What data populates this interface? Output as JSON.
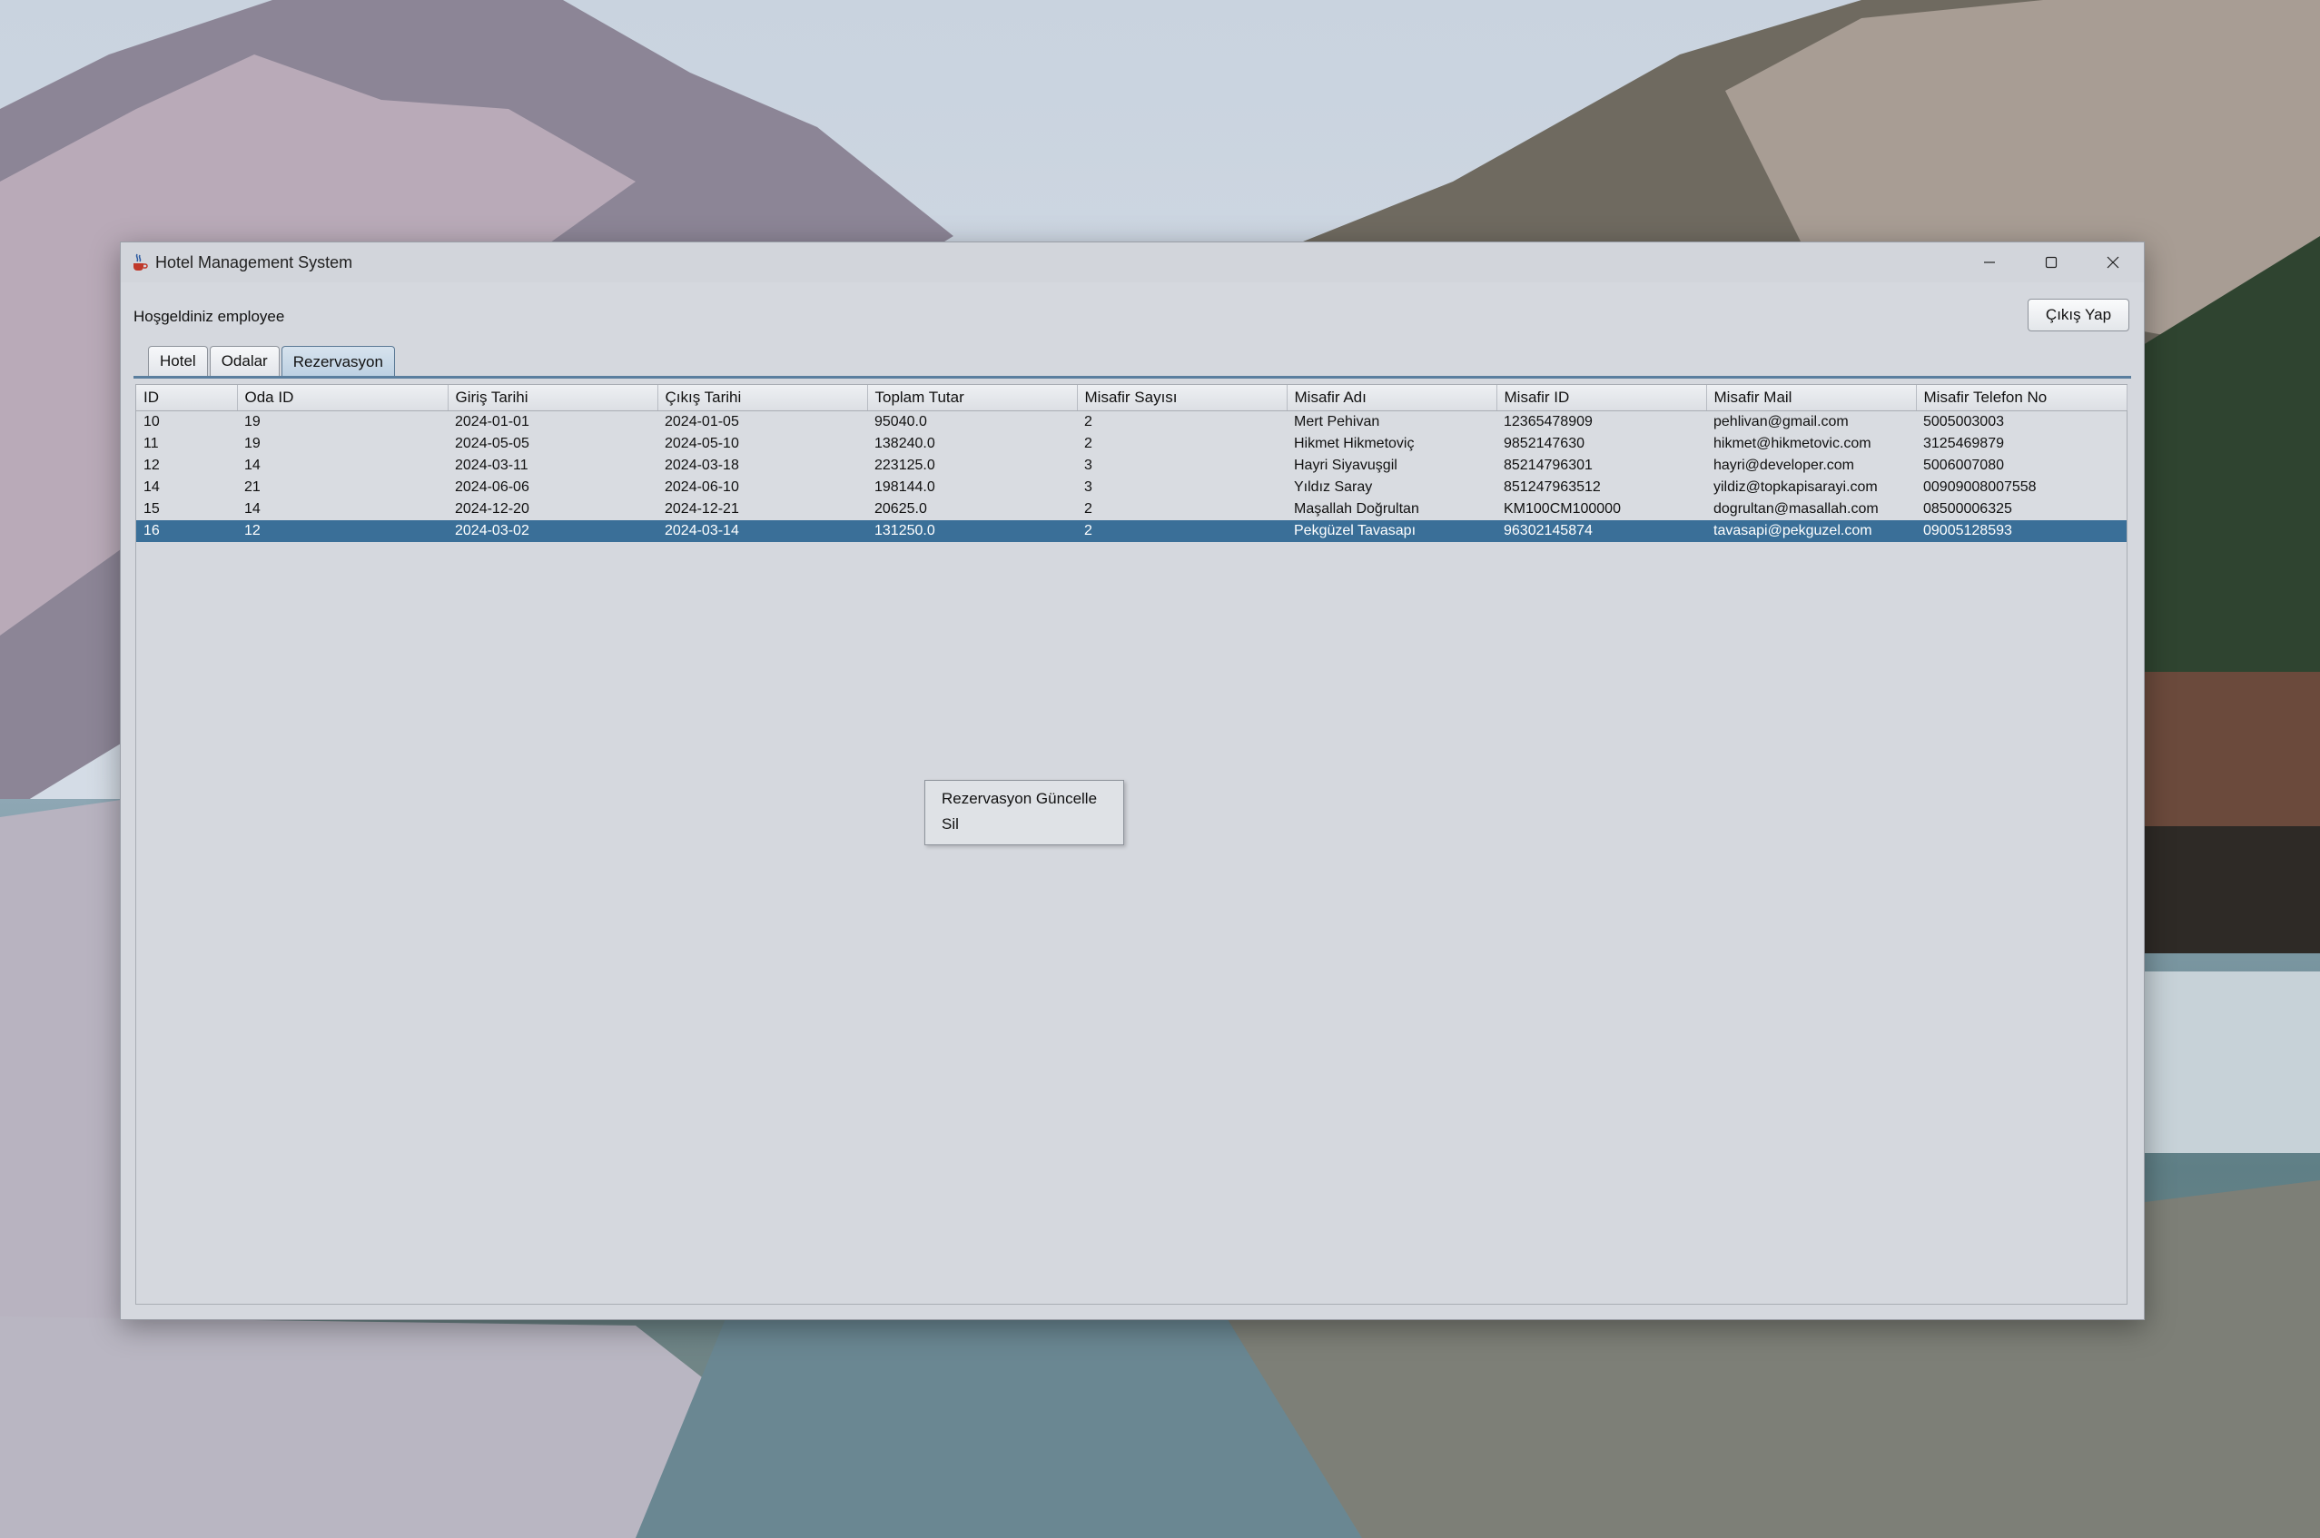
{
  "window": {
    "title": "Hotel Management System",
    "icon": "java-cup-icon"
  },
  "header": {
    "welcome_text": "Hoşgeldiniz employee",
    "logout_label": "Çıkış Yap"
  },
  "tabs": [
    {
      "label": "Hotel",
      "active": false
    },
    {
      "label": "Odalar",
      "active": false
    },
    {
      "label": "Rezervasyon",
      "active": true
    }
  ],
  "table": {
    "columns": [
      "ID",
      "Oda ID",
      "Giriş Tarihi",
      "Çıkış Tarihi",
      "Toplam Tutar",
      "Misafir Sayısı",
      "Misafir Adı",
      "Misafir ID",
      "Misafir Mail",
      "Misafir Telefon No"
    ],
    "rows": [
      [
        "10",
        "19",
        "2024-01-01",
        "2024-01-05",
        "95040.0",
        "2",
        "Mert Pehivan",
        "12365478909",
        "pehlivan@gmail.com",
        "5005003003"
      ],
      [
        "11",
        "19",
        "2024-05-05",
        "2024-05-10",
        "138240.0",
        "2",
        "Hikmet Hikmetoviç",
        "9852147630",
        "hikmet@hikmetovic.com",
        "3125469879"
      ],
      [
        "12",
        "14",
        "2024-03-11",
        "2024-03-18",
        "223125.0",
        "3",
        "Hayri Siyavuşgil",
        "85214796301",
        "hayri@developer.com",
        "5006007080"
      ],
      [
        "14",
        "21",
        "2024-06-06",
        "2024-06-10",
        "198144.0",
        "3",
        "Yıldız Saray",
        "851247963512",
        "yildiz@topkapisarayi.com",
        "00909008007558"
      ],
      [
        "15",
        "14",
        "2024-12-20",
        "2024-12-21",
        "20625.0",
        "2",
        "Maşallah Doğrultan",
        "KM100CM100000",
        "dogrultan@masallah.com",
        "08500006325"
      ],
      [
        "16",
        "12",
        "2024-03-02",
        "2024-03-14",
        "131250.0",
        "2",
        "Pekgüzel Tavasapı",
        "96302145874",
        "tavasapi@pekguzel.com",
        "09005128593"
      ]
    ],
    "selected_row_index": 5
  },
  "context_menu": {
    "items": [
      "Rezervasyon Güncelle",
      "Sil"
    ]
  },
  "colors": {
    "selection": "#3a6f98",
    "tab_underline": "#5a7e9e",
    "window_bg": "#d5d8de"
  }
}
